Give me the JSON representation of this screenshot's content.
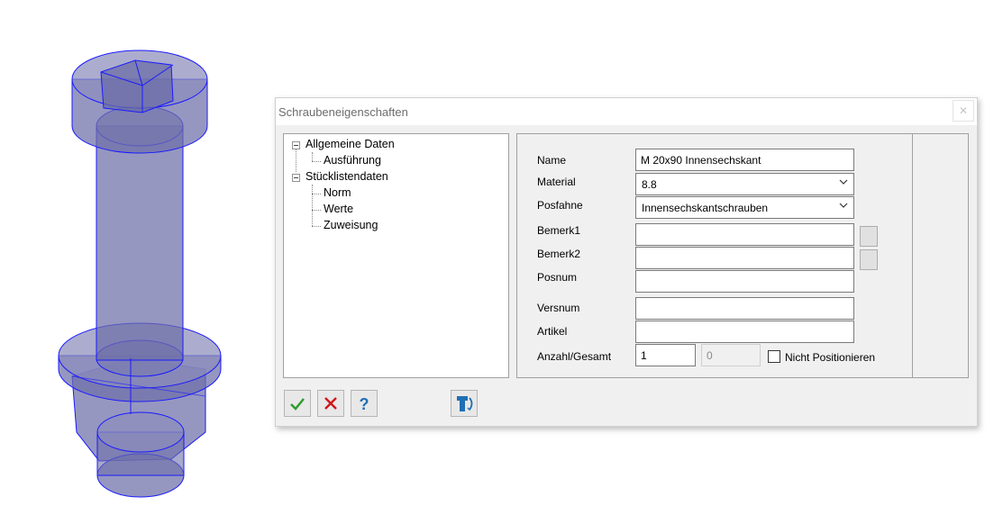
{
  "dialog": {
    "title": "Schraubeneigenschaften",
    "close_glyph": "✕"
  },
  "tree": {
    "items": [
      {
        "label": "Allgemeine Daten",
        "expander": true
      },
      {
        "label": "Ausführung"
      },
      {
        "label": "Stücklistendaten",
        "expander": true
      },
      {
        "label": "Norm"
      },
      {
        "label": "Werte"
      },
      {
        "label": "Zuweisung"
      }
    ]
  },
  "form": {
    "name": {
      "label": "Name",
      "value": "M 20x90 Innensechskant"
    },
    "material": {
      "label": "Material",
      "value": "8.8"
    },
    "posfahne": {
      "label": "Posfahne",
      "value": "Innensechskantschrauben"
    },
    "bemerk1": {
      "label": "Bemerk1",
      "value": ""
    },
    "bemerk2": {
      "label": "Bemerk2",
      "value": ""
    },
    "posnum": {
      "label": "Posnum",
      "value": ""
    },
    "versnum": {
      "label": "Versnum",
      "value": ""
    },
    "artikel": {
      "label": "Artikel",
      "value": ""
    },
    "anzahl": {
      "label": "Anzahl/Gesamt",
      "value": "1",
      "gesamt": "0"
    },
    "nicht_positionieren": {
      "label": "Nicht Positionieren",
      "checked": false
    }
  },
  "toolbar": {
    "icons": [
      "ok-checkmark-icon",
      "cancel-x-icon",
      "help-question-icon",
      "bolt-select-icon"
    ]
  },
  "colors": {
    "bolt_fill": "#7f80b0",
    "bolt_edge": "#1a1aff",
    "accent_blue": "#1f6fb5"
  }
}
